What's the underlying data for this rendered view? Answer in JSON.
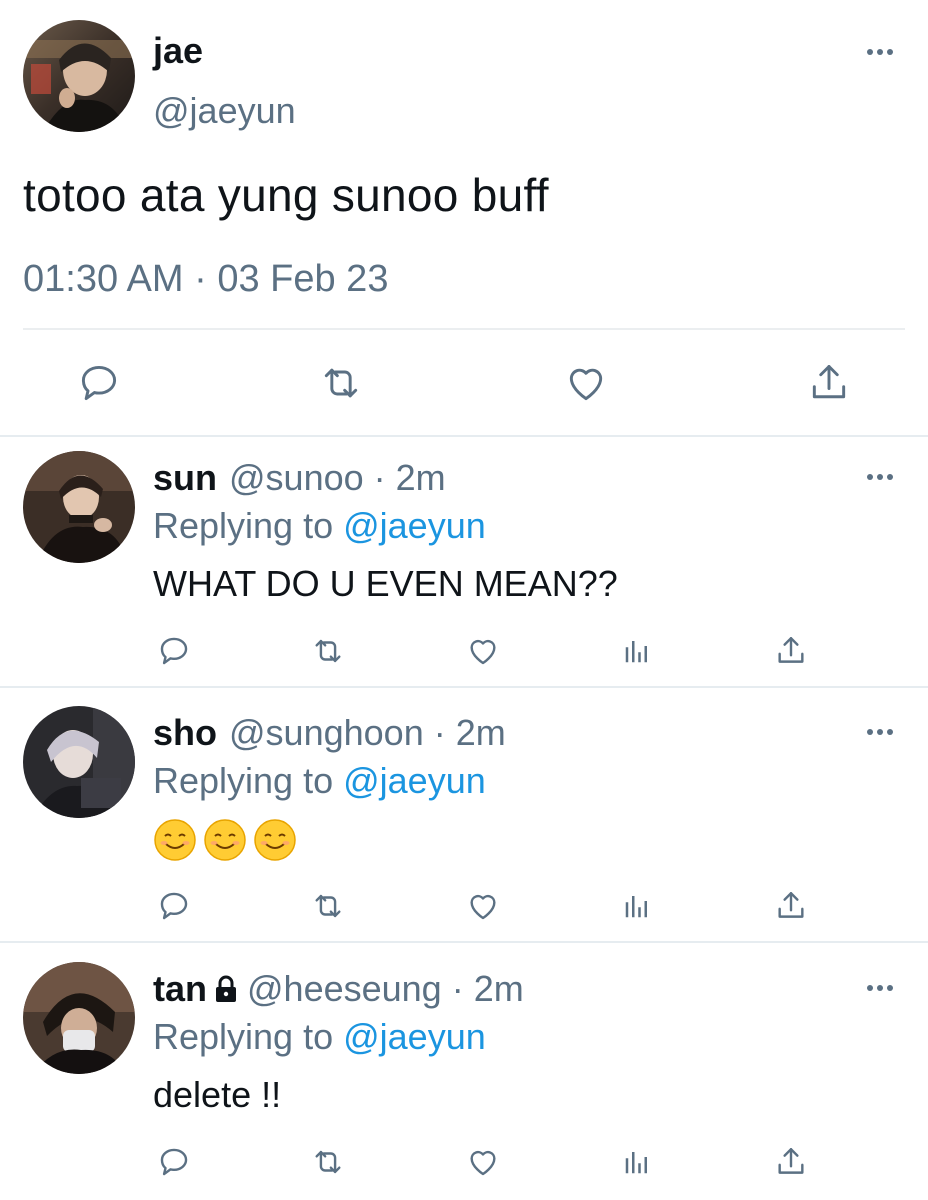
{
  "main_tweet": {
    "name": "jae",
    "handle": "@jaeyun",
    "text": "totoo ata yung sunoo buff",
    "meta": "01:30 AM · 03 Feb 23",
    "more_icon": "more-dots-icon",
    "actions": [
      "reply-icon",
      "retweet-icon",
      "like-icon",
      "share-icon"
    ]
  },
  "replies": [
    {
      "name": "sun",
      "handle": "@sunoo",
      "dot": " · ",
      "time": "2m",
      "replying_prefix": "Replying to ",
      "replying_to": "@jaeyun",
      "text": "WHAT DO U EVEN MEAN??",
      "locked": false
    },
    {
      "name": "sho",
      "handle": "@sunghoon",
      "dot": " · ",
      "time": "2m",
      "replying_prefix": "Replying to ",
      "replying_to": "@jaeyun",
      "text": "😊😊😊",
      "locked": false
    },
    {
      "name": "tan",
      "handle": "@heeseung",
      "dot": " · ",
      "time": "2m",
      "replying_prefix": "Replying to ",
      "replying_to": "@jaeyun",
      "text": "delete !!",
      "locked": true
    }
  ],
  "colors": {
    "text": "#0f1419",
    "secondary": "#5b7083",
    "link": "#1b95e0",
    "divider": "#e6ecf0",
    "icon": "#5b7083"
  }
}
